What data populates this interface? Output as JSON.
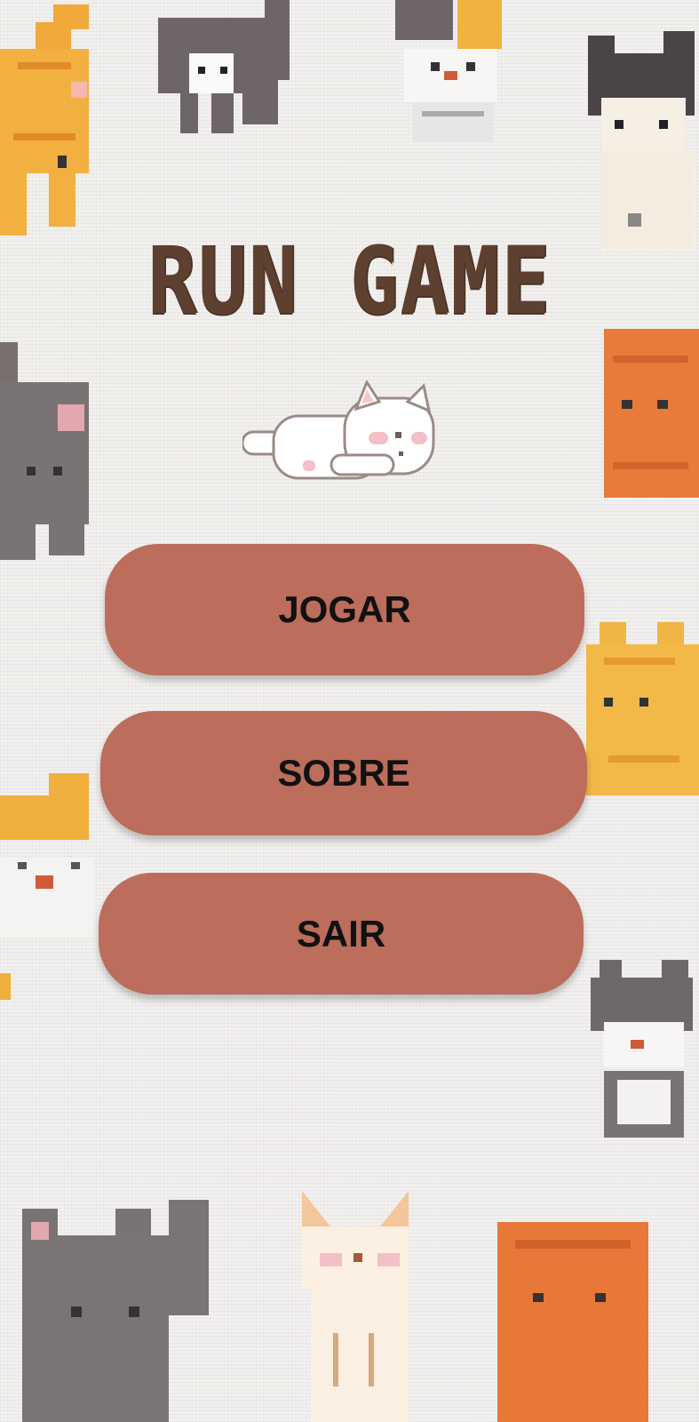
{
  "title": "RUN GAME",
  "menu": {
    "play_label": "JOGAR",
    "about_label": "SOBRE",
    "exit_label": "SAIR"
  },
  "colors": {
    "background": "#f3f1ef",
    "title": "#5e4030",
    "button": "#bc6d5b",
    "button_text": "#111111"
  },
  "decorations": [
    "orange-cat",
    "gray-cat",
    "calico-cat",
    "white-cat",
    "cream-cat"
  ]
}
